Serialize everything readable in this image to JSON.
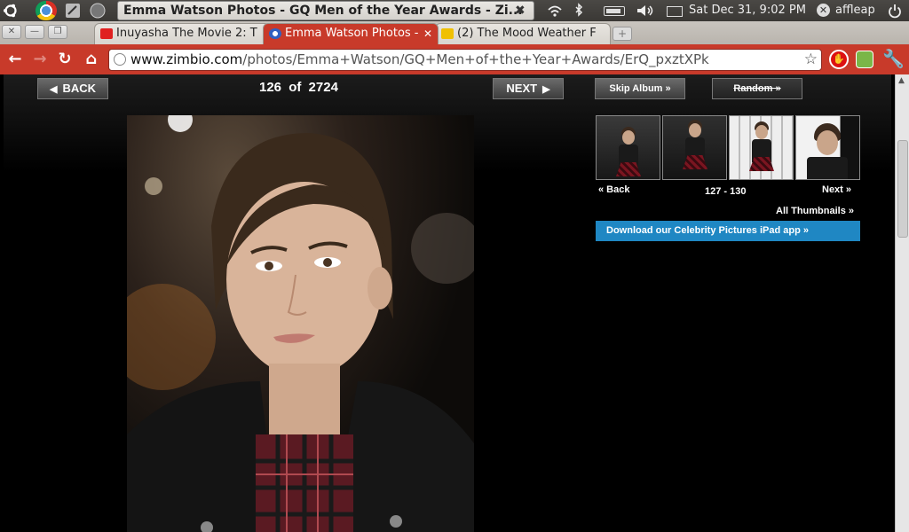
{
  "system_panel": {
    "window_title": "Emma Watson Photos - GQ Men of the Year Awards - Zi...",
    "clock": "Sat Dec 31,  9:02 PM",
    "user": "affleap"
  },
  "tabs": [
    {
      "label": "Inuyasha The Movie 2: T"
    },
    {
      "label": "Emma Watson Photos - "
    },
    {
      "label": "(2) The Mood Weather F"
    }
  ],
  "address_bar": {
    "host": "www.zimbio.com",
    "path": "/photos/Emma+Watson/GQ+Men+of+the+Year+Awards/ErQ_pxztXPk"
  },
  "gallery": {
    "back_label": "BACK",
    "next_label": "NEXT",
    "current": "126",
    "of_word": "of",
    "total": "2724"
  },
  "sidebar": {
    "skip_album": "Skip Album »",
    "random": "Random »",
    "thumbs_back": "« Back",
    "thumbs_range": "127 - 130",
    "thumbs_next": "Next »",
    "all_thumbnails": "All Thumbnails »",
    "ipad_promo": "Download our Celebrity Pictures iPad app »"
  },
  "colors": {
    "browser_accent": "#c83a2a",
    "promo_blue": "#1f87c3"
  }
}
